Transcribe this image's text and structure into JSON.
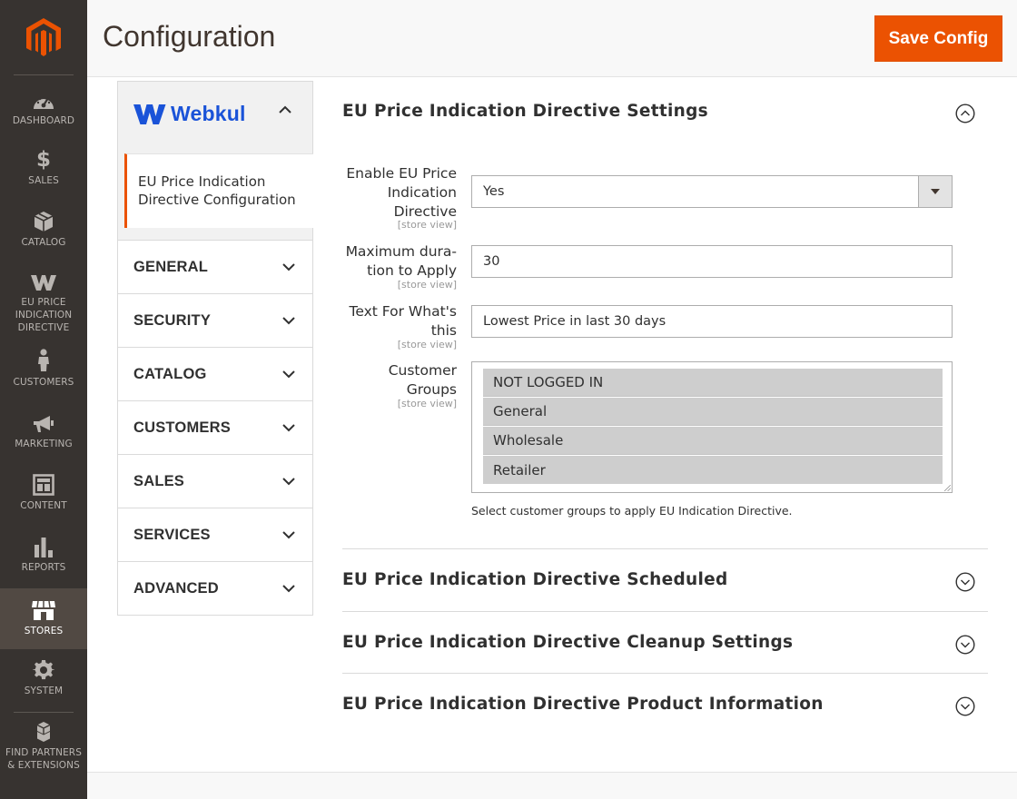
{
  "nav": {
    "items": [
      {
        "label": "DASHBOARD",
        "icon": "dashboard-icon"
      },
      {
        "label": "SALES",
        "icon": "dollar-icon"
      },
      {
        "label": "CATALOG",
        "icon": "cube-icon"
      },
      {
        "label": "EU PRICE INDICATION DIRECTIVE",
        "icon": "webkul-icon"
      },
      {
        "label": "CUSTOMERS",
        "icon": "person-icon"
      },
      {
        "label": "MARKETING",
        "icon": "megaphone-icon"
      },
      {
        "label": "CONTENT",
        "icon": "layout-icon"
      },
      {
        "label": "REPORTS",
        "icon": "bar-chart-icon"
      },
      {
        "label": "STORES",
        "icon": "store-icon"
      },
      {
        "label": "SYSTEM",
        "icon": "gear-icon"
      },
      {
        "label": "FIND PARTNERS & EXTENSIONS",
        "icon": "boxes-icon"
      }
    ],
    "label_1": "DASHBOARD",
    "label_2": "SALES",
    "label_3": "CATALOG",
    "label_4a": "EU PRICE",
    "label_4b": "INDICATION",
    "label_4c": "DIRECTIVE",
    "label_5": "CUSTOMERS",
    "label_6": "MARKETING",
    "label_7": "CONTENT",
    "label_8": "REPORTS",
    "label_9": "STORES",
    "label_10": "SYSTEM",
    "label_11a": "FIND PARTNERS",
    "label_11b": "& EXTENSIONS",
    "active": "STORES"
  },
  "header": {
    "title": "Configuration",
    "save_label": "Save Config"
  },
  "tabs": {
    "vendor": "Webkul",
    "vendor_sub_line1": "EU Price Indication",
    "vendor_sub_line2": "Directive Configuration",
    "items": [
      "GENERAL",
      "SECURITY",
      "CATALOG",
      "CUSTOMERS",
      "SALES",
      "SERVICES",
      "ADVANCED"
    ]
  },
  "settings": {
    "title": "EU Price Indication Directive Settings",
    "enable_label_1": "Enable EU Price",
    "enable_label_2": "Indication",
    "enable_label_3": "Directive",
    "enable_value": "Yes",
    "duration_label_1": "Maximum dura-",
    "duration_label_2": "tion to Apply",
    "duration_value": "30",
    "text_label_1": "Text For What's",
    "text_label_2": "this",
    "text_value": "Lowest Price in last 30 days",
    "groups_label_1": "Customer",
    "groups_label_2": "Groups",
    "scope": "[store view]",
    "groups": [
      "NOT LOGGED IN",
      "General",
      "Wholesale",
      "Retailer"
    ],
    "groups_note": "Select customer groups to apply EU Indication Directive."
  },
  "sections": {
    "scheduled": "EU Price Indication Directive Scheduled",
    "cleanup": "EU Price Indication Directive Cleanup Settings",
    "product_info": "EU Price Indication Directive Product Information"
  },
  "colors": {
    "accent": "#eb5202",
    "nav_bg": "#373330",
    "webkul_blue": "#1a53d8"
  }
}
